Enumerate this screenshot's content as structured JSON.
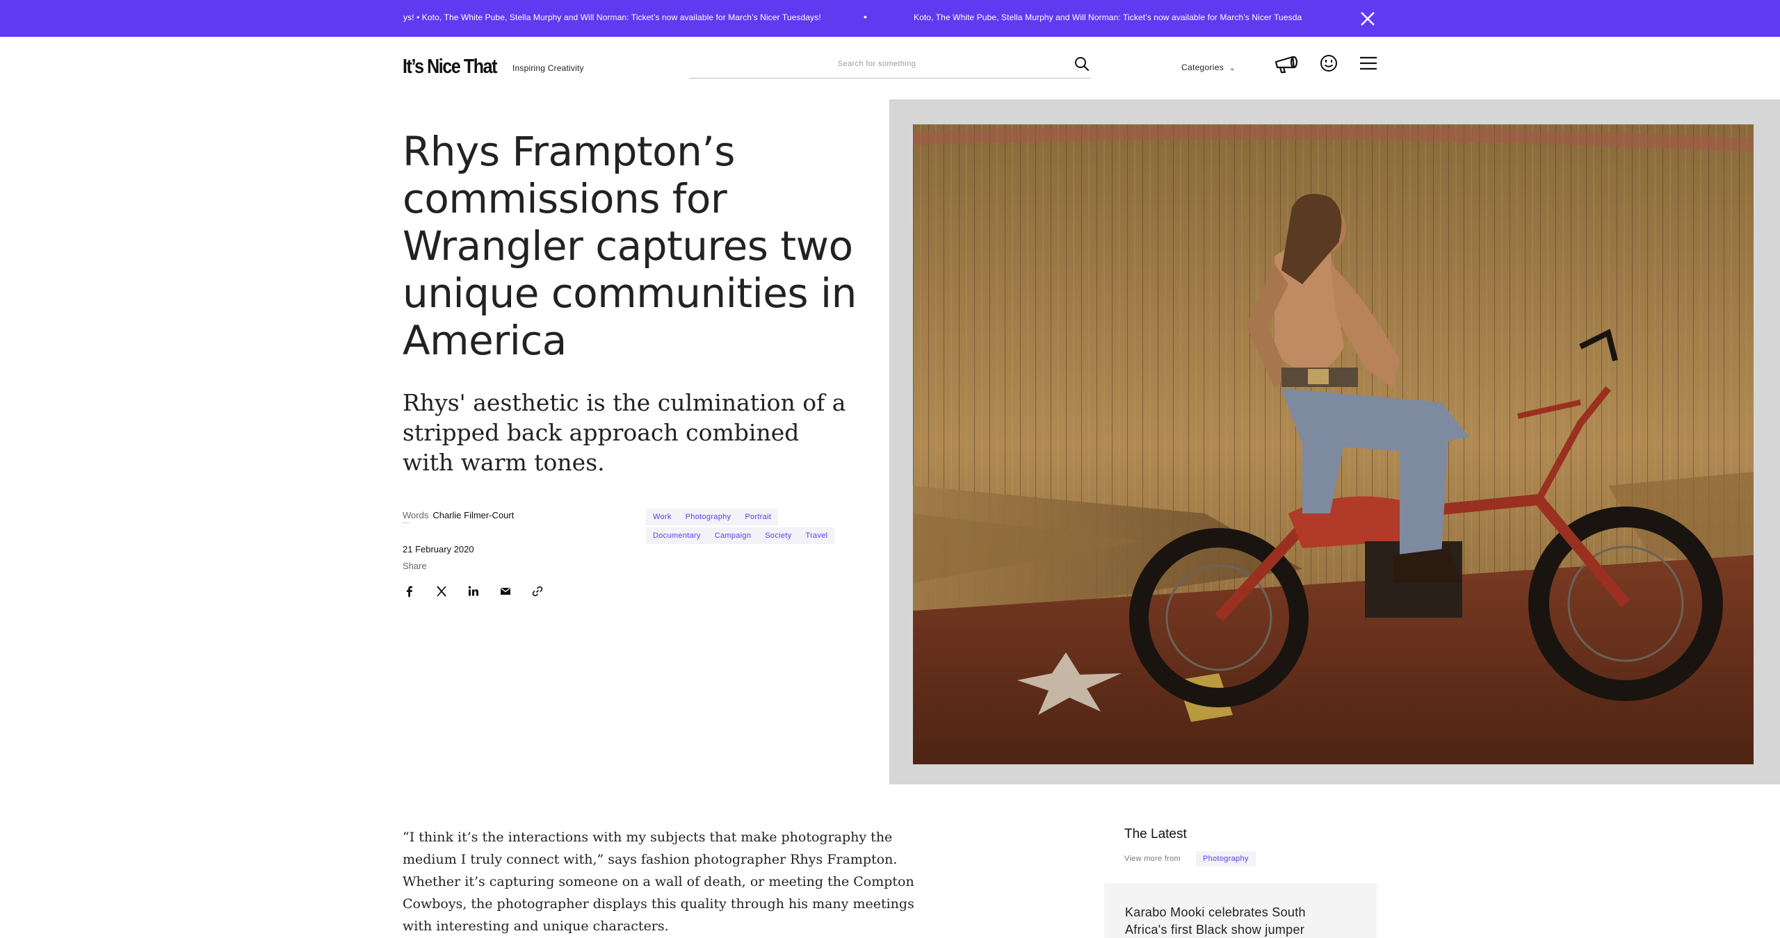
{
  "banner": {
    "ticker_1": "ys! • Koto, The White Pube, Stella Murphy and Will Norman: Ticket’s now available for March’s Nicer Tuesdays!",
    "separator": "•",
    "ticker_2": "Koto, The White Pube, Stella Murphy and Will Norman: Ticket’s now available for March’s Nicer Tuesda",
    "background_color": "#5f3af0"
  },
  "header": {
    "logo": "It’s Nice That",
    "tagline": "Inspiring Creativity",
    "search_placeholder": "Search for something",
    "categories_label": "Categories",
    "icons": [
      "search-icon",
      "chevron-down-icon",
      "megaphone-icon",
      "smiley-icon",
      "menu-icon"
    ]
  },
  "article": {
    "headline": "Rhys Frampton’s commissions for Wrangler captures two unique communities in America",
    "standfirst": "Rhys' aesthetic is the culmination of a stripped back approach combined with warm tones.",
    "words_label": "Words",
    "author": "Charlie Filmer-Court",
    "date": "21 February 2020",
    "share_label": "Share",
    "share_icons": [
      "facebook-icon",
      "x-icon",
      "linkedin-icon",
      "email-icon",
      "link-icon"
    ],
    "tags_row_1": [
      "Work",
      "Photography",
      "Portrait"
    ],
    "tags_row_2": [
      "Documentary",
      "Campaign",
      "Society",
      "Travel"
    ],
    "body_paragraph": "“I think it’s the interactions with my subjects that make photography the medium I truly connect with,” says fashion photographer Rhys Frampton. Whether it’s capturing someone on a wall of death, or meeting the Compton Cowboys, the photographer displays this quality through his many meetings with interesting and unique characters."
  },
  "latest": {
    "title": "The Latest",
    "view_more_label": "View more from",
    "view_more_tag": "Photography",
    "card_title": "Karabo Mooki celebrates South Africa's first Black show jumper"
  },
  "colors": {
    "accent": "#5f3af0",
    "tag_bg": "#f2f2f7",
    "hero_frame": "#d6d6d6"
  }
}
